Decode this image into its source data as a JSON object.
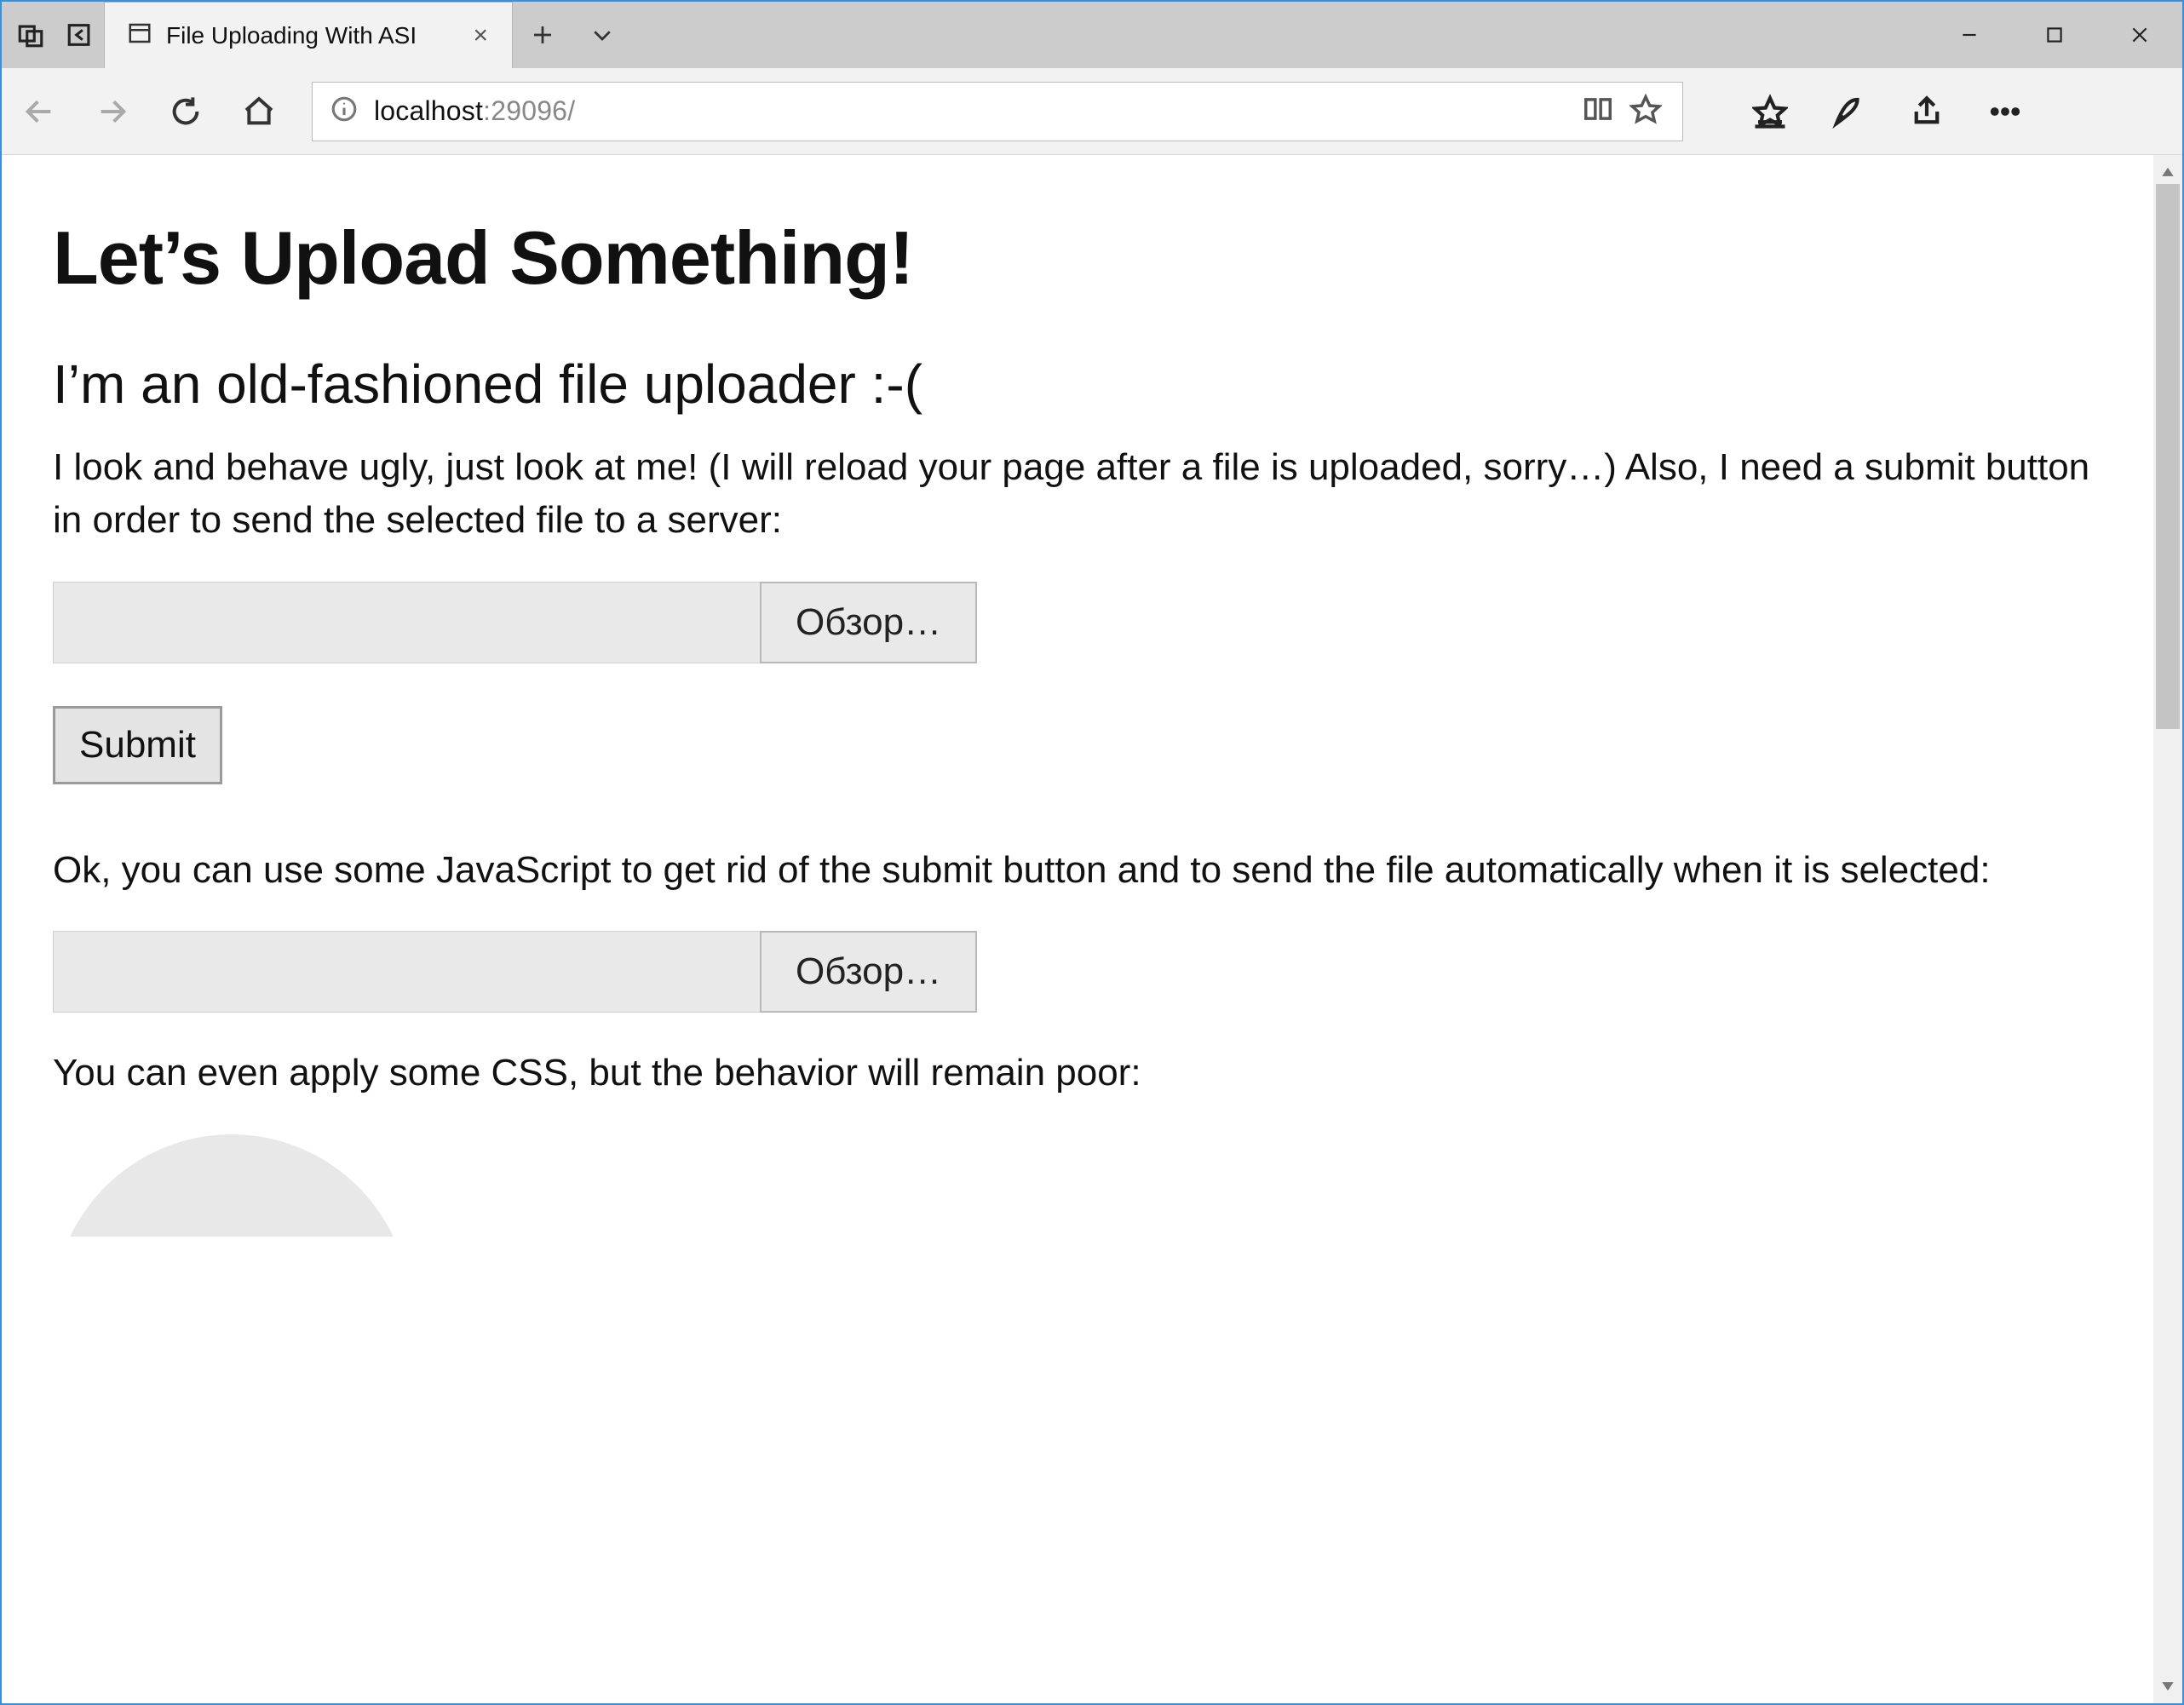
{
  "window": {
    "tab_title": "File Uploading With ASI",
    "minimize_aria": "Minimize",
    "maximize_aria": "Maximize",
    "close_aria": "Close"
  },
  "toolbar": {
    "url_host": "localhost",
    "url_port": ":29096",
    "url_path": "/"
  },
  "page": {
    "h1": "Let’s Upload Something!",
    "h2": "I’m an old-fashioned file uploader :-(",
    "p1": "I look and behave ugly, just look at me! (I will reload your page after a file is uploaded, sorry…) Also, I need a submit button in order to send the selected file to a server:",
    "browse_label": "Обзор…",
    "submit_label": "Submit",
    "p2": "Ok, you can use some JavaScript to get rid of the submit button and to send the file automatically when it is selected:",
    "browse_label_2": "Обзор…",
    "p3": "You can even apply some CSS, but the behavior will remain poor:"
  }
}
